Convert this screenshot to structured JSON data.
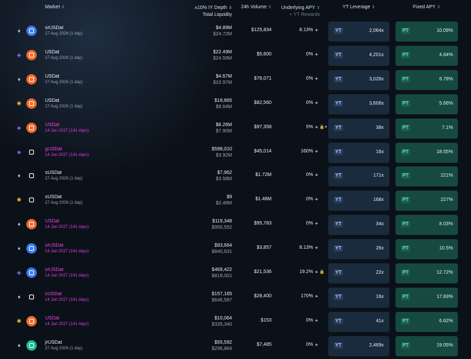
{
  "header": {
    "market": "Market",
    "depth": "±10% IY Depth",
    "liquidity": "Total Liquidity",
    "volume": "24h Volume",
    "apy": "Underlying APY",
    "yt_rewards": "+ YT Rewards",
    "yt_leverage": "YT Leverage",
    "fixed_apy": "Fixed APY"
  },
  "rows": [
    {
      "chain": "eth",
      "token_color": "blue",
      "name": "srUSDat",
      "date": "27 Aug 2026 (1 day)",
      "highlight": false,
      "depth": "$4.89M",
      "liq": "$24.72M",
      "vol": "$125,834",
      "apy": "8.13%",
      "apy_icons": [
        "spark"
      ],
      "yt_label": "YT",
      "yt": "2,064x",
      "pt_label": "PT",
      "pt": "10.09%"
    },
    {
      "chain": "arb",
      "token_color": "orange",
      "name": "USDat",
      "date": "27 Aug 2026 (1 day)",
      "highlight": false,
      "depth": "$22.49M",
      "liq": "$24.59M",
      "vol": "$5,600",
      "apy": "0%",
      "apy_icons": [
        "spark"
      ],
      "yt_label": "YT",
      "yt": "4,201x",
      "pt_label": "PT",
      "pt": "4.84%"
    },
    {
      "chain": "eth",
      "token_color": "orange",
      "name": "USDat",
      "date": "27 Aug 2026 (1 day)",
      "highlight": false,
      "depth": "$4.67M",
      "liq": "$10.97M",
      "vol": "$76,071",
      "apy": "0%",
      "apy_icons": [
        "spark"
      ],
      "yt_label": "YT",
      "yt": "3,026x",
      "pt_label": "PT",
      "pt": "6.78%"
    },
    {
      "chain": "bnb",
      "token_color": "orange",
      "name": "USDat",
      "date": "27 Aug 2026 (1 day)",
      "highlight": false,
      "depth": "$18,865",
      "liq": "$9.64M",
      "vol": "$82,560",
      "apy": "0%",
      "apy_icons": [
        "spark"
      ],
      "yt_label": "YT",
      "yt": "3,606x",
      "pt_label": "PT",
      "pt": "5.66%"
    },
    {
      "chain": "arb",
      "token_color": "orange",
      "name": "USDat",
      "date": "14 Jan 2027 (141 days)",
      "highlight": true,
      "depth": "$6.26M",
      "liq": "$7.90M",
      "vol": "$97,358",
      "apy": "5%",
      "apy_icons": [
        "spark",
        "lock",
        "spark"
      ],
      "yt_label": "YT",
      "yt": "38x",
      "pt_label": "PT",
      "pt": "7.1%"
    },
    {
      "chain": "arb",
      "token_color": "black",
      "name": "gUSDat",
      "date": "14 Jan 2027 (141 days)",
      "highlight": true,
      "depth": "$598,010",
      "liq": "$3.92M",
      "vol": "$45,014",
      "apy": "160%",
      "apy_icons": [
        "spark"
      ],
      "yt_label": "YT",
      "yt": "16x",
      "pt_label": "PT",
      "pt": "18.55%"
    },
    {
      "chain": "eth",
      "token_color": "black",
      "name": "sUSDat",
      "date": "27 Aug 2026 (1 day)",
      "highlight": false,
      "depth": "$7,962",
      "liq": "$3.58M",
      "vol": "$1.72M",
      "apy": "0%",
      "apy_icons": [
        "spark"
      ],
      "yt_label": "YT",
      "yt": "171x",
      "pt_label": "PT",
      "pt": "221%"
    },
    {
      "chain": "bnb",
      "token_color": "black",
      "name": "sUSDat",
      "date": "27 Aug 2026 (1 day)",
      "highlight": false,
      "depth": "$9",
      "liq": "$2.46M",
      "vol": "$1.48M",
      "apy": "0%",
      "apy_icons": [
        "spark"
      ],
      "yt_label": "YT",
      "yt": "168x",
      "pt_label": "PT",
      "pt": "227%"
    },
    {
      "chain": "eth",
      "token_color": "orange",
      "name": "USDat",
      "date": "14 Jan 2027 (141 days)",
      "highlight": true,
      "depth": "$119,348",
      "liq": "$950,552",
      "vol": "$95,783",
      "apy": "0%",
      "apy_icons": [
        "spark"
      ],
      "yt_label": "YT",
      "yt": "34x",
      "pt_label": "PT",
      "pt": "8.03%"
    },
    {
      "chain": "eth",
      "token_color": "blue",
      "name": "srUSDat",
      "date": "14 Jan 2027 (141 days)",
      "highlight": true,
      "depth": "$93,664",
      "liq": "$840,631",
      "vol": "$3,857",
      "apy": "8.13%",
      "apy_icons": [
        "spark"
      ],
      "yt_label": "YT",
      "yt": "26x",
      "pt_label": "PT",
      "pt": "10.5%"
    },
    {
      "chain": "arb",
      "token_color": "blue",
      "name": "srUSDat",
      "date": "14 Jan 2027 (141 days)",
      "highlight": true,
      "depth": "$469,422",
      "liq": "$818,001",
      "vol": "$21,536",
      "apy": "19.2%",
      "apy_icons": [
        "spark",
        "lock"
      ],
      "yt_label": "YT",
      "yt": "22x",
      "pt_label": "PT",
      "pt": "12.72%"
    },
    {
      "chain": "eth",
      "token_color": "black",
      "name": "sUSDat",
      "date": "14 Jan 2027 (141 days)",
      "highlight": true,
      "depth": "$157,165",
      "liq": "$646,587",
      "vol": "$28,400",
      "apy": "170%",
      "apy_icons": [
        "spark"
      ],
      "yt_label": "YT",
      "yt": "16x",
      "pt_label": "PT",
      "pt": "17.83%"
    },
    {
      "chain": "bnb",
      "token_color": "orange",
      "name": "USDat",
      "date": "14 Jan 2027 (141 days)",
      "highlight": true,
      "depth": "$10,064",
      "liq": "$335,340",
      "vol": "$153",
      "apy": "0%",
      "apy_icons": [
        "spark"
      ],
      "yt_label": "YT",
      "yt": "41x",
      "pt_label": "PT",
      "pt": "6.62%"
    },
    {
      "chain": "eth",
      "token_color": "green",
      "name": "jrUSDat",
      "date": "27 Aug 2026 (1 day)",
      "highlight": false,
      "depth": "$55,592",
      "liq": "$296,864",
      "vol": "$7,485",
      "apy": "0%",
      "apy_icons": [
        "spark"
      ],
      "yt_label": "YT",
      "yt": "2,469x",
      "pt_label": "PT",
      "pt": "19.05%"
    }
  ]
}
